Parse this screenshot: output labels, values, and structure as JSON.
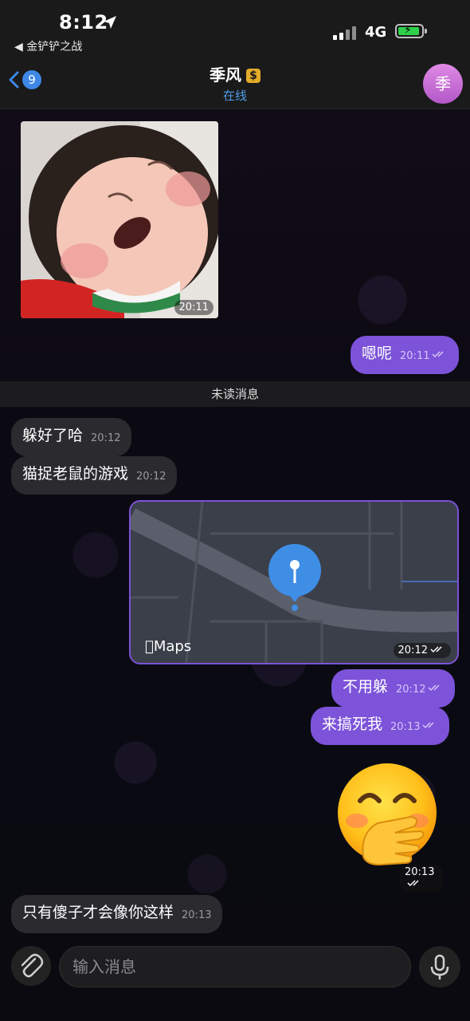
{
  "status_bar": {
    "time": "8:12",
    "back_app": "◀ 金铲铲之战",
    "network": "4G"
  },
  "header": {
    "unread_count": "9",
    "title": "季风",
    "status": "在线",
    "avatar_text": "季"
  },
  "messages": {
    "photo_time": "20:11",
    "m1_text": "嗯呢",
    "m1_time": "20:11",
    "divider": "未读消息",
    "m2_text": "躲好了哈",
    "m2_time": "20:12",
    "m3_text": "猫捉老鼠的游戏",
    "m3_time": "20:12",
    "map_label": "Maps",
    "map_time": "20:12",
    "m4_text": "不用躲",
    "m4_time": "20:12",
    "m5_text": "来搞死我",
    "m5_time": "20:13",
    "emoji_time": "20:13",
    "m6_text": "只有傻子才会像你这样",
    "m6_time": "20:13"
  },
  "input": {
    "placeholder": "输入消息"
  },
  "colors": {
    "accent": "#7c53d9",
    "link": "#4f9de8",
    "badge": "#3e87e6",
    "incoming_bubble": "#2b2b2f"
  }
}
